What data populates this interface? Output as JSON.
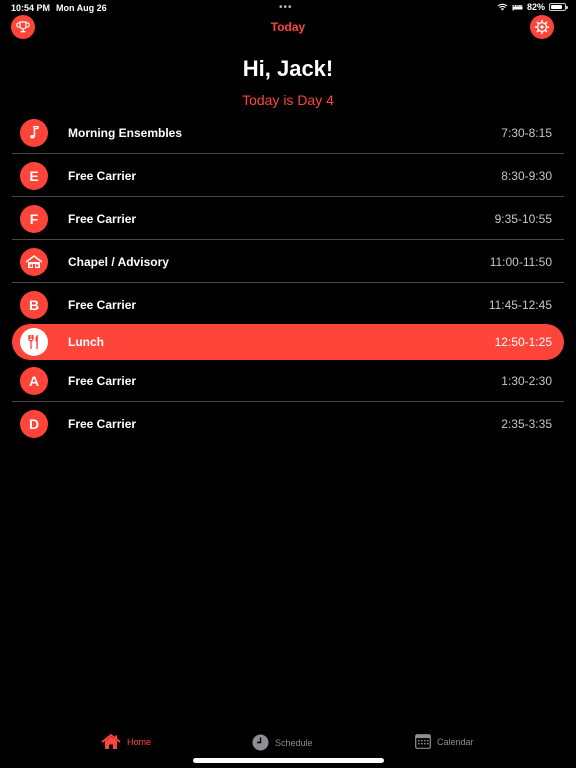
{
  "status": {
    "time": "10:54 PM",
    "date": "Mon Aug 26",
    "multitask": "•••",
    "battery_text": "82%",
    "battery_level": 0.82
  },
  "nav": {
    "title": "Today"
  },
  "header": {
    "greeting": "Hi, Jack!",
    "day": "Today is Day 4"
  },
  "colors": {
    "accent": "#ff453a",
    "background": "#000000",
    "divider": "#48484a",
    "muted": "#8e8e93"
  },
  "schedule": [
    {
      "badge": "",
      "icon": "music-note-icon",
      "name": "Morning Ensembles",
      "time": "7:30-8:15",
      "active": false
    },
    {
      "badge": "E",
      "icon": "",
      "name": "Free Carrier",
      "time": "8:30-9:30",
      "active": false
    },
    {
      "badge": "F",
      "icon": "",
      "name": "Free Carrier",
      "time": "9:35-10:55",
      "active": false
    },
    {
      "badge": "",
      "icon": "chapel-icon",
      "name": "Chapel / Advisory",
      "time": "11:00-11:50",
      "active": false
    },
    {
      "badge": "B",
      "icon": "",
      "name": "Free Carrier",
      "time": "11:45-12:45",
      "active": false
    },
    {
      "badge": "",
      "icon": "fork-knife-icon",
      "name": "Lunch",
      "time": "12:50-1:25",
      "active": true
    },
    {
      "badge": "A",
      "icon": "",
      "name": "Free Carrier",
      "time": "1:30-2:30",
      "active": false
    },
    {
      "badge": "D",
      "icon": "",
      "name": "Free Carrier",
      "time": "2:35-3:35",
      "active": false
    }
  ],
  "tabs": [
    {
      "label": "Home",
      "icon": "house-icon",
      "selected": true
    },
    {
      "label": "Schedule",
      "icon": "clock-icon",
      "selected": false
    },
    {
      "label": "Calendar",
      "icon": "calendar-icon",
      "selected": false
    }
  ]
}
